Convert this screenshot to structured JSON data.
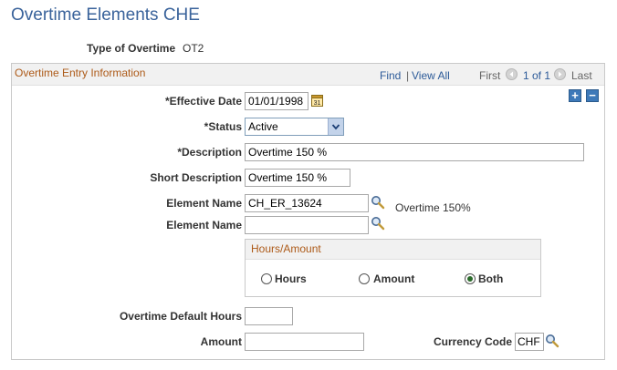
{
  "page": {
    "title": "Overtime Elements CHE"
  },
  "header": {
    "type_label": "Type of Overtime",
    "type_value": "OT2"
  },
  "panel": {
    "title": "Overtime Entry Information",
    "find": "Find",
    "separator": "|",
    "view_all": "View All",
    "first": "First",
    "counter": "1 of 1",
    "last": "Last",
    "add_symbol": "+",
    "remove_symbol": "−"
  },
  "form": {
    "effective_date": {
      "label": "*Effective Date",
      "value": "01/01/1998",
      "icon": "calendar-icon"
    },
    "status": {
      "label": "*Status",
      "value": "Active"
    },
    "description": {
      "label": "*Description",
      "value": "Overtime 150 %"
    },
    "short_description": {
      "label": "Short Description",
      "value": "Overtime 150 %"
    },
    "element_name_1": {
      "label": "Element Name",
      "value": "CH_ER_13624",
      "desc": "Overtime 150%"
    },
    "element_name_2": {
      "label": "Element Name",
      "value": ""
    },
    "hours_amount": {
      "title": "Hours/Amount",
      "options": [
        "Hours",
        "Amount",
        "Both"
      ],
      "selected": "Both"
    },
    "default_hours": {
      "label": "Overtime Default Hours",
      "value": ""
    },
    "amount": {
      "label": "Amount",
      "value": ""
    },
    "currency": {
      "label": "Currency Code",
      "value": "CHF"
    }
  },
  "colors": {
    "title": "#3a639b",
    "panel_title": "#ad5a18",
    "link": "#2d5b99"
  }
}
